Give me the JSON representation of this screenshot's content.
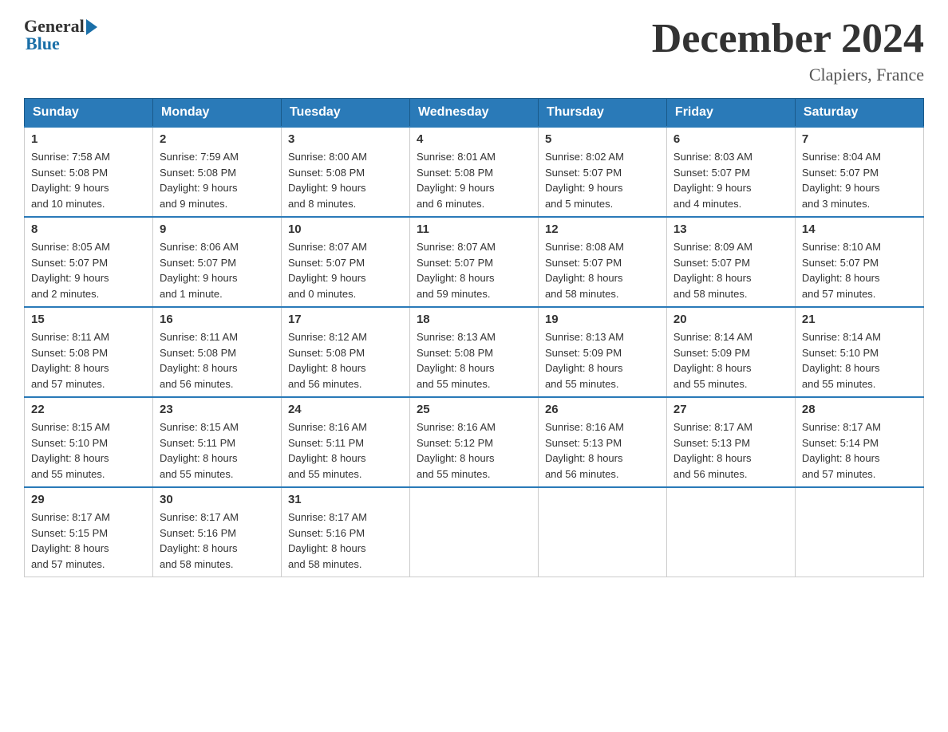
{
  "logo": {
    "general": "General",
    "blue": "Blue"
  },
  "title": "December 2024",
  "location": "Clapiers, France",
  "days_of_week": [
    "Sunday",
    "Monday",
    "Tuesday",
    "Wednesday",
    "Thursday",
    "Friday",
    "Saturday"
  ],
  "weeks": [
    [
      {
        "day": "1",
        "sunrise": "7:58 AM",
        "sunset": "5:08 PM",
        "daylight": "9 hours and 10 minutes."
      },
      {
        "day": "2",
        "sunrise": "7:59 AM",
        "sunset": "5:08 PM",
        "daylight": "9 hours and 9 minutes."
      },
      {
        "day": "3",
        "sunrise": "8:00 AM",
        "sunset": "5:08 PM",
        "daylight": "9 hours and 8 minutes."
      },
      {
        "day": "4",
        "sunrise": "8:01 AM",
        "sunset": "5:08 PM",
        "daylight": "9 hours and 6 minutes."
      },
      {
        "day": "5",
        "sunrise": "8:02 AM",
        "sunset": "5:07 PM",
        "daylight": "9 hours and 5 minutes."
      },
      {
        "day": "6",
        "sunrise": "8:03 AM",
        "sunset": "5:07 PM",
        "daylight": "9 hours and 4 minutes."
      },
      {
        "day": "7",
        "sunrise": "8:04 AM",
        "sunset": "5:07 PM",
        "daylight": "9 hours and 3 minutes."
      }
    ],
    [
      {
        "day": "8",
        "sunrise": "8:05 AM",
        "sunset": "5:07 PM",
        "daylight": "9 hours and 2 minutes."
      },
      {
        "day": "9",
        "sunrise": "8:06 AM",
        "sunset": "5:07 PM",
        "daylight": "9 hours and 1 minute."
      },
      {
        "day": "10",
        "sunrise": "8:07 AM",
        "sunset": "5:07 PM",
        "daylight": "9 hours and 0 minutes."
      },
      {
        "day": "11",
        "sunrise": "8:07 AM",
        "sunset": "5:07 PM",
        "daylight": "8 hours and 59 minutes."
      },
      {
        "day": "12",
        "sunrise": "8:08 AM",
        "sunset": "5:07 PM",
        "daylight": "8 hours and 58 minutes."
      },
      {
        "day": "13",
        "sunrise": "8:09 AM",
        "sunset": "5:07 PM",
        "daylight": "8 hours and 58 minutes."
      },
      {
        "day": "14",
        "sunrise": "8:10 AM",
        "sunset": "5:07 PM",
        "daylight": "8 hours and 57 minutes."
      }
    ],
    [
      {
        "day": "15",
        "sunrise": "8:11 AM",
        "sunset": "5:08 PM",
        "daylight": "8 hours and 57 minutes."
      },
      {
        "day": "16",
        "sunrise": "8:11 AM",
        "sunset": "5:08 PM",
        "daylight": "8 hours and 56 minutes."
      },
      {
        "day": "17",
        "sunrise": "8:12 AM",
        "sunset": "5:08 PM",
        "daylight": "8 hours and 56 minutes."
      },
      {
        "day": "18",
        "sunrise": "8:13 AM",
        "sunset": "5:08 PM",
        "daylight": "8 hours and 55 minutes."
      },
      {
        "day": "19",
        "sunrise": "8:13 AM",
        "sunset": "5:09 PM",
        "daylight": "8 hours and 55 minutes."
      },
      {
        "day": "20",
        "sunrise": "8:14 AM",
        "sunset": "5:09 PM",
        "daylight": "8 hours and 55 minutes."
      },
      {
        "day": "21",
        "sunrise": "8:14 AM",
        "sunset": "5:10 PM",
        "daylight": "8 hours and 55 minutes."
      }
    ],
    [
      {
        "day": "22",
        "sunrise": "8:15 AM",
        "sunset": "5:10 PM",
        "daylight": "8 hours and 55 minutes."
      },
      {
        "day": "23",
        "sunrise": "8:15 AM",
        "sunset": "5:11 PM",
        "daylight": "8 hours and 55 minutes."
      },
      {
        "day": "24",
        "sunrise": "8:16 AM",
        "sunset": "5:11 PM",
        "daylight": "8 hours and 55 minutes."
      },
      {
        "day": "25",
        "sunrise": "8:16 AM",
        "sunset": "5:12 PM",
        "daylight": "8 hours and 55 minutes."
      },
      {
        "day": "26",
        "sunrise": "8:16 AM",
        "sunset": "5:13 PM",
        "daylight": "8 hours and 56 minutes."
      },
      {
        "day": "27",
        "sunrise": "8:17 AM",
        "sunset": "5:13 PM",
        "daylight": "8 hours and 56 minutes."
      },
      {
        "day": "28",
        "sunrise": "8:17 AM",
        "sunset": "5:14 PM",
        "daylight": "8 hours and 57 minutes."
      }
    ],
    [
      {
        "day": "29",
        "sunrise": "8:17 AM",
        "sunset": "5:15 PM",
        "daylight": "8 hours and 57 minutes."
      },
      {
        "day": "30",
        "sunrise": "8:17 AM",
        "sunset": "5:16 PM",
        "daylight": "8 hours and 58 minutes."
      },
      {
        "day": "31",
        "sunrise": "8:17 AM",
        "sunset": "5:16 PM",
        "daylight": "8 hours and 58 minutes."
      },
      null,
      null,
      null,
      null
    ]
  ],
  "labels": {
    "sunrise": "Sunrise:",
    "sunset": "Sunset:",
    "daylight": "Daylight:"
  }
}
